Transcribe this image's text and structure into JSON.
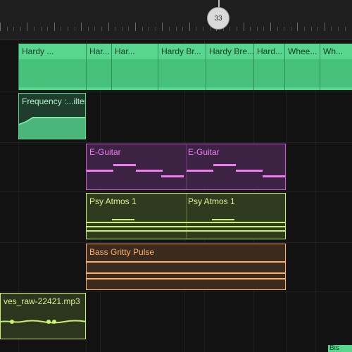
{
  "playhead": {
    "position_label": "33"
  },
  "tracks": {
    "audio_main": {
      "segments": [
        {
          "label": "Hardy ..."
        },
        {
          "label": "Har..."
        },
        {
          "label": "Har..."
        },
        {
          "label": "Hardy Br..."
        },
        {
          "label": "Hardy Bre..."
        },
        {
          "label": "Hard..."
        },
        {
          "label": "Whee..."
        },
        {
          "label": "Wh..."
        }
      ]
    },
    "automation": {
      "label": "Frequency :...ilter"
    },
    "eguitar": {
      "labels": [
        "E-Guitar",
        "E-Guitar"
      ]
    },
    "psy": {
      "labels": [
        "Psy Atmos 1",
        "Psy Atmos 1"
      ]
    },
    "bass": {
      "label": "Bass Gritty Pulse"
    },
    "waves": {
      "label": "ves_raw-22421.mp3"
    },
    "corner": {
      "label": "Bis"
    }
  },
  "colors": {
    "green": "#58d58e",
    "magenta": "#d058d0",
    "lime": "#c7f06d",
    "orange": "#ffb06a"
  }
}
